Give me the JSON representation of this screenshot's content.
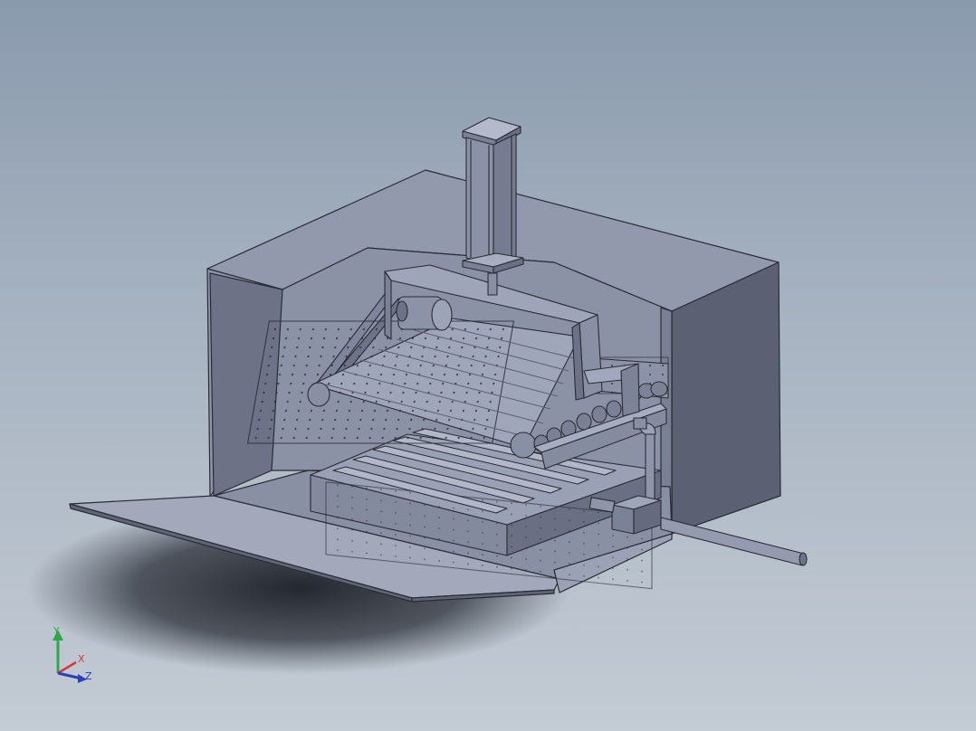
{
  "triad": {
    "y_label": "Y",
    "x_label": "X",
    "z_label": "Z",
    "y_color": "#2fa84a",
    "x_color": "#d23a3a",
    "z_color": "#2a3fb8"
  },
  "colors": {
    "background_top": "#8a9aad",
    "background_bottom": "#c3cbd4",
    "model_face_light": "#9aa0b4",
    "model_face_mid": "#7f859a",
    "model_face_dark": "#5e6376",
    "edge": "#2a2c35"
  }
}
